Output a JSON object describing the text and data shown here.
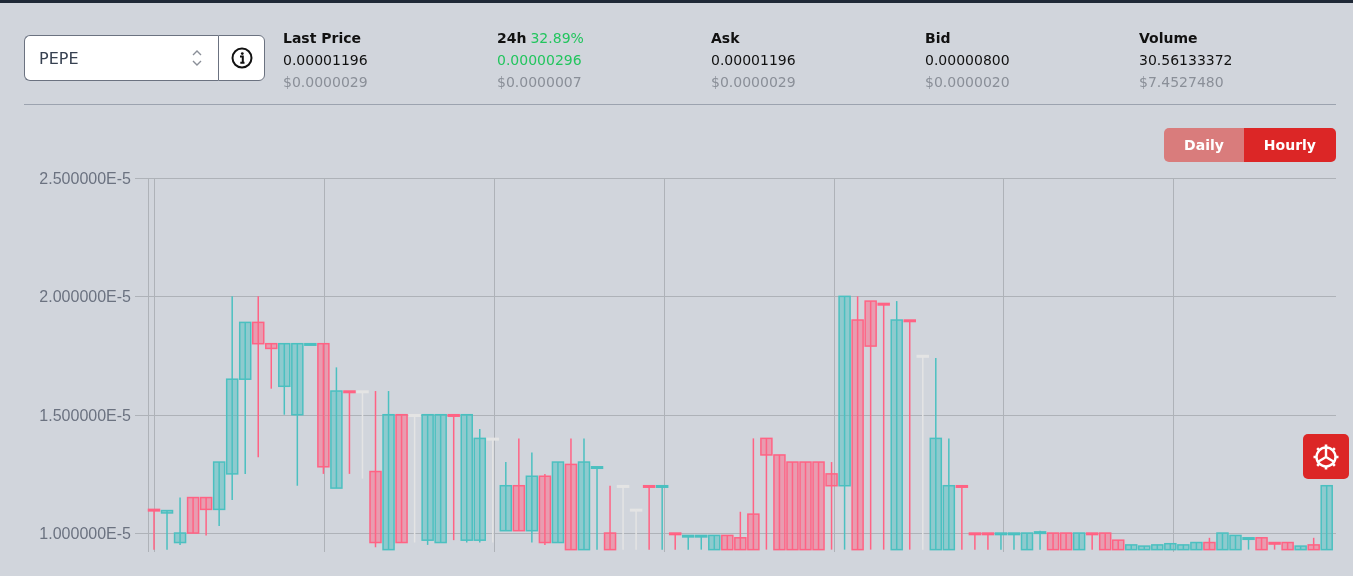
{
  "pair_select": {
    "value": "PEPE"
  },
  "stats": [
    {
      "kind": "price",
      "label": "Last Price",
      "value": "0.00001196",
      "usd": "$0.0000029"
    },
    {
      "kind": "change",
      "label": "24h",
      "change": "32.89%",
      "value": "0.00000296",
      "usd": "$0.0000007"
    },
    {
      "kind": "price",
      "label": "Ask",
      "value": "0.00001196",
      "usd": "$0.0000029"
    },
    {
      "kind": "price",
      "label": "Bid",
      "value": "0.00000800",
      "usd": "$0.0000020"
    },
    {
      "kind": "price",
      "label": "Volume",
      "value": "30.56133372",
      "usd": "$7.4527480"
    }
  ],
  "interval_toggle": [
    {
      "label": "Daily",
      "selected": false
    },
    {
      "label": "Hourly",
      "selected": true
    }
  ],
  "chart": {
    "chart_data": {
      "type": "candlestick",
      "grid": true,
      "ylim": [
        9.2e-06,
        2.5e-05
      ],
      "yticks": [
        {
          "value": 2.5e-05,
          "label": "2.500000E-5"
        },
        {
          "value": 2e-05,
          "label": "2.000000E-5"
        },
        {
          "value": 1.5e-05,
          "label": "1.500000E-5"
        },
        {
          "value": 1e-05,
          "label": "1.000000E-5"
        }
      ],
      "ohlc": [
        [
          1.1e-05,
          1.1e-05,
          9.3e-06,
          1.098e-05
        ],
        [
          1.085e-05,
          1.095e-05,
          9.3e-06,
          1.095e-05
        ],
        [
          9.6e-06,
          1.15e-05,
          9.5e-06,
          1e-05
        ],
        [
          1.15e-05,
          1.15e-05,
          1e-05,
          1e-05
        ],
        [
          1.15e-05,
          1.15e-05,
          9.9e-06,
          1.1e-05
        ],
        [
          1.1e-05,
          1.3e-05,
          1.03e-05,
          1.3e-05
        ],
        [
          1.25e-05,
          2e-05,
          1.14e-05,
          1.65e-05
        ],
        [
          1.65e-05,
          1.89e-05,
          1.25e-05,
          1.89e-05
        ],
        [
          1.89e-05,
          2e-05,
          1.32e-05,
          1.8e-05
        ],
        [
          1.8e-05,
          1.8e-05,
          1.61e-05,
          1.78e-05
        ],
        [
          1.62e-05,
          1.8e-05,
          1.5e-05,
          1.8e-05
        ],
        [
          1.5e-05,
          1.8e-05,
          1.2e-05,
          1.8e-05
        ],
        [
          1.795e-05,
          1.8e-05,
          1.795e-05,
          1.8e-05
        ],
        [
          1.8e-05,
          1.8e-05,
          1.25e-05,
          1.28e-05
        ],
        [
          1.19e-05,
          1.7e-05,
          1.19e-05,
          1.6e-05
        ],
        [
          1.6e-05,
          1.6e-05,
          1.25e-05,
          1.598e-05
        ],
        [
          1.6e-05,
          1.6e-05,
          1.23e-05,
          1.6e-05
        ],
        [
          1.26e-05,
          1.6e-05,
          9.4e-06,
          9.6e-06
        ],
        [
          9.3e-06,
          1.6e-05,
          9.3e-06,
          1.5e-05
        ],
        [
          1.5e-05,
          1.5e-05,
          9.6e-06,
          9.6e-06
        ],
        [
          1.5e-05,
          1.5e-05,
          9.6e-06,
          1.5e-05
        ],
        [
          9.7e-06,
          1.5e-05,
          9.5e-06,
          1.5e-05
        ],
        [
          9.6e-06,
          1.5e-05,
          9.6e-06,
          1.5e-05
        ],
        [
          1.5e-05,
          1.5e-05,
          9.7e-06,
          1.498e-05
        ],
        [
          9.7e-06,
          1.5e-05,
          9.6e-06,
          1.5e-05
        ],
        [
          9.7e-06,
          1.44e-05,
          9.6e-06,
          1.4e-05
        ],
        [
          1.4e-05,
          1.4e-05,
          9.6e-06,
          1.4e-05
        ],
        [
          1.01e-05,
          1.3e-05,
          1.01e-05,
          1.2e-05
        ],
        [
          1.2e-05,
          1.4e-05,
          1.01e-05,
          1.01e-05
        ],
        [
          1.01e-05,
          1.34e-05,
          9.6e-06,
          1.24e-05
        ],
        [
          1.24e-05,
          1.25e-05,
          9.5e-06,
          9.6e-06
        ],
        [
          9.6e-06,
          1.3e-05,
          9.6e-06,
          1.3e-05
        ],
        [
          1.29e-05,
          1.4e-05,
          9.3e-06,
          9.3e-06
        ],
        [
          9.3e-06,
          1.4e-05,
          9.3e-06,
          1.3e-05
        ],
        [
          1.278e-05,
          1.28e-05,
          9.3e-06,
          1.28e-05
        ],
        [
          1e-05,
          1.2e-05,
          9.3e-06,
          9.3e-06
        ],
        [
          1.2e-05,
          1.2e-05,
          9.3e-06,
          1.2e-05
        ],
        [
          1.1e-05,
          1.1e-05,
          9.3e-06,
          1.1e-05
        ],
        [
          1.2e-05,
          1.2e-05,
          9.3e-06,
          1.198e-05
        ],
        [
          1.198e-05,
          1.2e-05,
          9.3e-06,
          1.2e-05
        ],
        [
          1e-05,
          1e-05,
          9.3e-06,
          9.98e-06
        ],
        [
          9.88e-06,
          9.9e-06,
          9.3e-06,
          9.9e-06
        ],
        [
          9.85e-06,
          9.9e-06,
          9.3e-06,
          9.9e-06
        ],
        [
          9.3e-06,
          9.9e-06,
          9.3e-06,
          9.9e-06
        ],
        [
          9.9e-06,
          9.9e-06,
          9.3e-06,
          9.3e-06
        ],
        [
          9.8e-06,
          1.09e-05,
          9.3e-06,
          9.3e-06
        ],
        [
          1.08e-05,
          1.4e-05,
          9.3e-06,
          9.3e-06
        ],
        [
          1.4e-05,
          1.4e-05,
          9.3e-06,
          1.33e-05
        ],
        [
          1.33e-05,
          1.33e-05,
          9.3e-06,
          9.3e-06
        ],
        [
          1.3e-05,
          1.3e-05,
          9.3e-06,
          9.3e-06
        ],
        [
          1.3e-05,
          1.3e-05,
          9.3e-06,
          9.3e-06
        ],
        [
          1.3e-05,
          1.3e-05,
          9.3e-06,
          9.3e-06
        ],
        [
          1.25e-05,
          1.3e-05,
          9.3e-06,
          1.2e-05
        ],
        [
          1.2e-05,
          2e-05,
          9.3e-06,
          2e-05
        ],
        [
          1.9e-05,
          2e-05,
          9.3e-06,
          9.3e-06
        ],
        [
          1.98e-05,
          1.98e-05,
          9.3e-06,
          1.79e-05
        ],
        [
          1.97e-05,
          1.97e-05,
          9.3e-06,
          1.968e-05
        ],
        [
          9.3e-06,
          1.98e-05,
          9.3e-06,
          1.9e-05
        ],
        [
          1.9e-05,
          1.9e-05,
          9.3e-06,
          1.898e-05
        ],
        [
          1.75e-05,
          1.75e-05,
          9.3e-06,
          1.75e-05
        ],
        [
          9.3e-06,
          1.74e-05,
          9.3e-06,
          1.4e-05
        ],
        [
          9.3e-06,
          1.4e-05,
          9.3e-06,
          1.2e-05
        ],
        [
          1.2e-05,
          1.2e-05,
          9.3e-06,
          1.198e-05
        ],
        [
          1e-05,
          1e-05,
          9.3e-06,
          9.98e-06
        ],
        [
          1e-05,
          1e-05,
          9.3e-06,
          9.98e-06
        ],
        [
          9.98e-06,
          1e-05,
          9.3e-06,
          1e-05
        ],
        [
          9.98e-06,
          1e-05,
          9.3e-06,
          1e-05
        ],
        [
          9.3e-06,
          1e-05,
          9.3e-06,
          1e-05
        ],
        [
          1e-05,
          1.01e-05,
          9.3e-06,
          1.005e-05
        ],
        [
          1e-05,
          1e-05,
          9.3e-06,
          9.3e-06
        ],
        [
          1e-05,
          1e-05,
          9.3e-06,
          9.3e-06
        ],
        [
          9.3e-06,
          1e-05,
          9.3e-06,
          1e-05
        ],
        [
          1e-05,
          1e-05,
          9.3e-06,
          9.98e-06
        ],
        [
          1e-05,
          1e-05,
          9.3e-06,
          9.3e-06
        ],
        [
          9.7e-06,
          9.7e-06,
          9.3e-06,
          9.3e-06
        ],
        [
          9.3e-06,
          9.5e-06,
          9.3e-06,
          9.5e-06
        ],
        [
          9.3e-06,
          9.45e-06,
          9.3e-06,
          9.45e-06
        ],
        [
          9.3e-06,
          9.5e-06,
          9.3e-06,
          9.5e-06
        ],
        [
          9.3e-06,
          9.55e-06,
          9.3e-06,
          9.55e-06
        ],
        [
          9.3e-06,
          9.5e-06,
          9.3e-06,
          9.5e-06
        ],
        [
          9.3e-06,
          9.6e-06,
          9.3e-06,
          9.6e-06
        ],
        [
          9.6e-06,
          9.8e-06,
          9.3e-06,
          9.3e-06
        ],
        [
          9.3e-06,
          1e-05,
          9.3e-06,
          1e-05
        ],
        [
          9.3e-06,
          9.9e-06,
          9.3e-06,
          9.9e-06
        ],
        [
          9.75e-06,
          9.8e-06,
          9.3e-06,
          9.8e-06
        ],
        [
          9.8e-06,
          9.8e-06,
          9.3e-06,
          9.3e-06
        ],
        [
          9.6e-06,
          9.6e-06,
          9.3e-06,
          9.58e-06
        ],
        [
          9.6e-06,
          9.6e-06,
          9.3e-06,
          9.3e-06
        ],
        [
          9.3e-06,
          9.45e-06,
          9.3e-06,
          9.45e-06
        ],
        [
          9.5e-06,
          9.8e-06,
          9.3e-06,
          9.3e-06
        ],
        [
          9.3e-06,
          1.2e-05,
          9.3e-06,
          1.2e-05
        ]
      ]
    }
  }
}
